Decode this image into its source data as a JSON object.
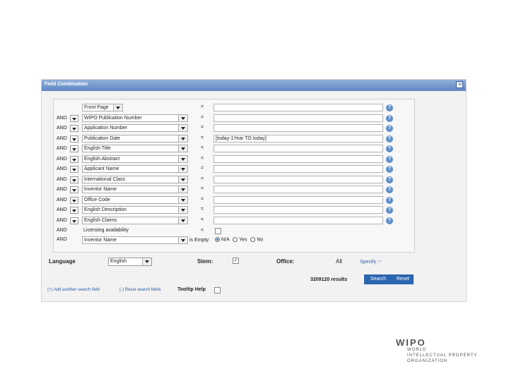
{
  "panel": {
    "title": "Field Combination",
    "collapse_icon": "⇲"
  },
  "rows": [
    {
      "op": "",
      "field": "Front Page",
      "eq": "=",
      "value": "",
      "help": "?"
    },
    {
      "op": "AND",
      "field": "WIPO Publication Number",
      "eq": "=",
      "value": "",
      "help": "?"
    },
    {
      "op": "AND",
      "field": "Application Number",
      "eq": "=",
      "value": "",
      "help": "?"
    },
    {
      "op": "AND",
      "field": "Publication Date",
      "eq": "=",
      "value": "[today-1Year TO today]",
      "help": "?"
    },
    {
      "op": "AND",
      "field": "English Title",
      "eq": "=",
      "value": "",
      "help": "?"
    },
    {
      "op": "AND",
      "field": "English Abstract",
      "eq": "=",
      "value": "",
      "help": "?"
    },
    {
      "op": "AND",
      "field": "Applicant Name",
      "eq": "=",
      "value": "",
      "help": "?"
    },
    {
      "op": "AND",
      "field": "International Class",
      "eq": "=",
      "value": "",
      "help": "?"
    },
    {
      "op": "AND",
      "field": "Inventor Name",
      "eq": "=",
      "value": "",
      "help": "?"
    },
    {
      "op": "AND",
      "field": "Office Code",
      "eq": "=",
      "value": "",
      "help": "?"
    },
    {
      "op": "AND",
      "field": "English Description",
      "eq": "=",
      "value": "",
      "help": "?"
    },
    {
      "op": "AND",
      "field": "English Claims",
      "eq": "=",
      "value": "",
      "help": "?"
    }
  ],
  "licensing_row": {
    "op": "AND",
    "label": "Licensing availability",
    "eq": "="
  },
  "empty_row": {
    "op": "AND",
    "field": "Inventor Name",
    "is_empty_label": "is Empty:",
    "options": [
      "N/A",
      "Yes",
      "No"
    ]
  },
  "options_bar": {
    "language_label": "Language",
    "language_value": "English",
    "stem_label": "Stem:",
    "stem_check": "✓",
    "office_label": "Office:",
    "office_value": "All",
    "specify_label": "Specify ☞"
  },
  "actions": {
    "results": "3209120 results",
    "search": "Search",
    "reset": "Reset",
    "add_field": "(+) Add another search field",
    "reset_fields": "(-) Reset search fields",
    "tooltip_help": "Tooltip Help"
  },
  "logo": {
    "name": "WIPO",
    "line1": "WORLD",
    "line2": "INTELLECTUAL PROPERTY",
    "line3": "ORGANIZATION"
  }
}
